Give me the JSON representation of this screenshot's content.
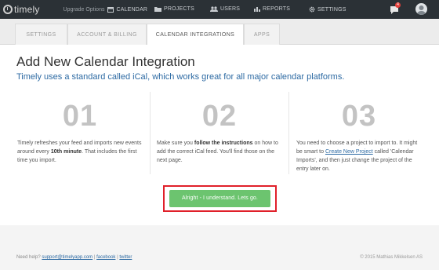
{
  "topbar": {
    "logo": "timely",
    "upgrade": "Upgrade Options",
    "nav": {
      "calendar": "CALENDAR",
      "projects": "PROJECTS",
      "users": "USERS",
      "reports": "REPORTS",
      "settings": "SETTINGS"
    },
    "notification_count": "4"
  },
  "tabs": [
    {
      "label": "SETTINGS",
      "active": false
    },
    {
      "label": "ACCOUNT & BILLING",
      "active": false
    },
    {
      "label": "CALENDAR INTEGRATIONS",
      "active": true
    },
    {
      "label": "APPS",
      "active": false
    }
  ],
  "main": {
    "title": "Add New Calendar Integration",
    "subtitle": "Timely uses a standard called iCal, which works great for all major calendar platforms.",
    "steps": [
      {
        "number": "01",
        "text_a": "Timely refreshes your feed and imports new events around every ",
        "text_b": "10th minute",
        "text_c": ". That includes the first time you import."
      },
      {
        "number": "02",
        "text_a": "Make sure you ",
        "text_b": "follow the instructions",
        "text_c": " on how to add the correct iCal feed. You'll find those on the next page."
      },
      {
        "number": "03",
        "text_a": "You need to choose a project to import to. It might be smart to ",
        "link": "Create New Project",
        "text_c": " called 'Calendar Imports', and then just change the project of the entry later on."
      }
    ],
    "button_label": "Alright - I understand. Lets go."
  },
  "footer": {
    "help": "Need help?",
    "email": "support@timelyapp.com",
    "sep1": " | ",
    "facebook": "facebook",
    "sep2": " | ",
    "twitter": "twitter",
    "copyright": "© 2015 Mathias Mikkelsen AS"
  },
  "colors": {
    "topbar": "#2b3136",
    "accent_blue": "#2d6aa3",
    "button_green": "#6cc46f",
    "highlight_red": "#e0202a"
  }
}
